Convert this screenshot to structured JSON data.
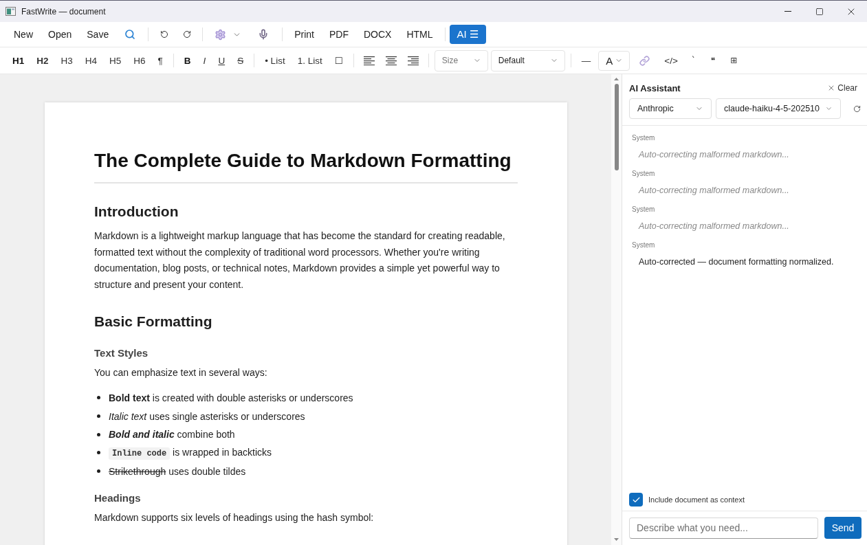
{
  "window": {
    "title": "FastWrite — document"
  },
  "toolbar": {
    "groups": [
      [
        {
          "kind": "text",
          "label": "New"
        },
        {
          "kind": "text",
          "label": "Open"
        },
        {
          "kind": "text",
          "label": "Save"
        },
        {
          "kind": "search"
        }
      ],
      [
        {
          "kind": "undo"
        },
        {
          "kind": "redo"
        }
      ],
      [
        {
          "kind": "settings_menu"
        },
        {
          "kind": "microphone"
        }
      ],
      [
        {
          "kind": "text",
          "label": "Print"
        },
        {
          "kind": "text",
          "label": "PDF"
        },
        {
          "kind": "text",
          "label": "DOCX"
        },
        {
          "kind": "text",
          "label": "HTML"
        }
      ]
    ],
    "ai_button": {
      "label": "AI ☰",
      "on": true
    }
  },
  "format_bar": {
    "groups": [
      [
        {
          "kind": "h1",
          "label": "H1"
        },
        {
          "kind": "h2",
          "label": "H2"
        },
        {
          "kind": "h3",
          "label": "H3"
        },
        {
          "kind": "h4",
          "label": "H4"
        },
        {
          "kind": "h5",
          "label": "H5"
        },
        {
          "kind": "h6",
          "label": "H6"
        },
        {
          "kind": "text",
          "label": "¶"
        }
      ],
      [
        {
          "kind": "bold",
          "label": "B"
        },
        {
          "kind": "italic",
          "label": "I"
        },
        {
          "kind": "underline",
          "label": "U"
        },
        {
          "kind": "strike",
          "label": "S"
        }
      ],
      [
        {
          "kind": "text",
          "label": "• List"
        },
        {
          "kind": "text",
          "label": "1. List"
        },
        {
          "kind": "text",
          "label": "☐"
        }
      ],
      [
        {
          "kind": "align_left"
        },
        {
          "kind": "align_center"
        },
        {
          "kind": "align_right"
        }
      ],
      [
        {
          "kind": "size_select",
          "placeholder": "Size"
        },
        {
          "kind": "font_select",
          "value": "Default"
        }
      ],
      [
        {
          "kind": "text",
          "label": "—"
        },
        {
          "kind": "color_select",
          "value": "A"
        },
        {
          "kind": "link"
        },
        {
          "kind": "text",
          "label": "</>"
        },
        {
          "kind": "symbol",
          "label": "`"
        },
        {
          "kind": "symbol",
          "label": "❝"
        },
        {
          "kind": "symbol",
          "label": "⊞"
        }
      ]
    ]
  },
  "document": {
    "title": "The Complete Guide to Markdown Formatting",
    "blocks": [
      {
        "kind": "h2",
        "text": "Introduction"
      },
      {
        "kind": "p",
        "text": "Markdown is a lightweight markup language that has become the standard for creating readable, formatted text without the complexity of traditional word processors. Whether you're writing documentation, blog posts, or technical notes, Markdown provides a simple yet powerful way to structure and present your content."
      },
      {
        "kind": "h2",
        "text": "Basic Formatting"
      },
      {
        "kind": "h3",
        "text": "Text Styles"
      },
      {
        "kind": "p",
        "text": "You can emphasize text in several ways:"
      },
      {
        "kind": "list",
        "items": [
          [
            {
              "kind": "bold",
              "text": "Bold text"
            },
            {
              "kind": "plain",
              "text": " is created with double asterisks or underscores"
            }
          ],
          [
            {
              "kind": "italic",
              "text": "Italic text"
            },
            {
              "kind": "plain",
              "text": " uses single asterisks or underscores"
            }
          ],
          [
            {
              "kind": "bold_italic",
              "text": "Bold and italic"
            },
            {
              "kind": "plain",
              "text": " combine both"
            }
          ],
          [
            {
              "kind": "code",
              "text": "Inline code"
            },
            {
              "kind": "plain",
              "text": " is wrapped in backticks"
            }
          ],
          [
            {
              "kind": "strike",
              "text": "Strikethrough"
            },
            {
              "kind": "plain",
              "text": " uses double tildes"
            }
          ]
        ]
      },
      {
        "kind": "h3",
        "text": "Headings"
      },
      {
        "kind": "p",
        "text": "Markdown supports six levels of headings using the hash symbol:"
      }
    ]
  },
  "ai_panel": {
    "title": "AI Assistant",
    "clear_label": "Clear",
    "provider": "Anthropic",
    "model": "claude-haiku-4-5-202510",
    "messages": [
      {
        "sender": "System",
        "kind": "status",
        "text": "Auto-correcting malformed markdown..."
      },
      {
        "sender": "System",
        "kind": "status",
        "text": "Auto-correcting malformed markdown..."
      },
      {
        "sender": "System",
        "kind": "status",
        "text": "Auto-correcting malformed markdown..."
      },
      {
        "sender": "System",
        "kind": "result",
        "text": "Auto-corrected — document formatting normalized."
      }
    ],
    "include_context": {
      "label": "Include document as context",
      "checked": true
    },
    "input": {
      "placeholder": "Describe what you need..."
    },
    "send_label": "Send"
  }
}
